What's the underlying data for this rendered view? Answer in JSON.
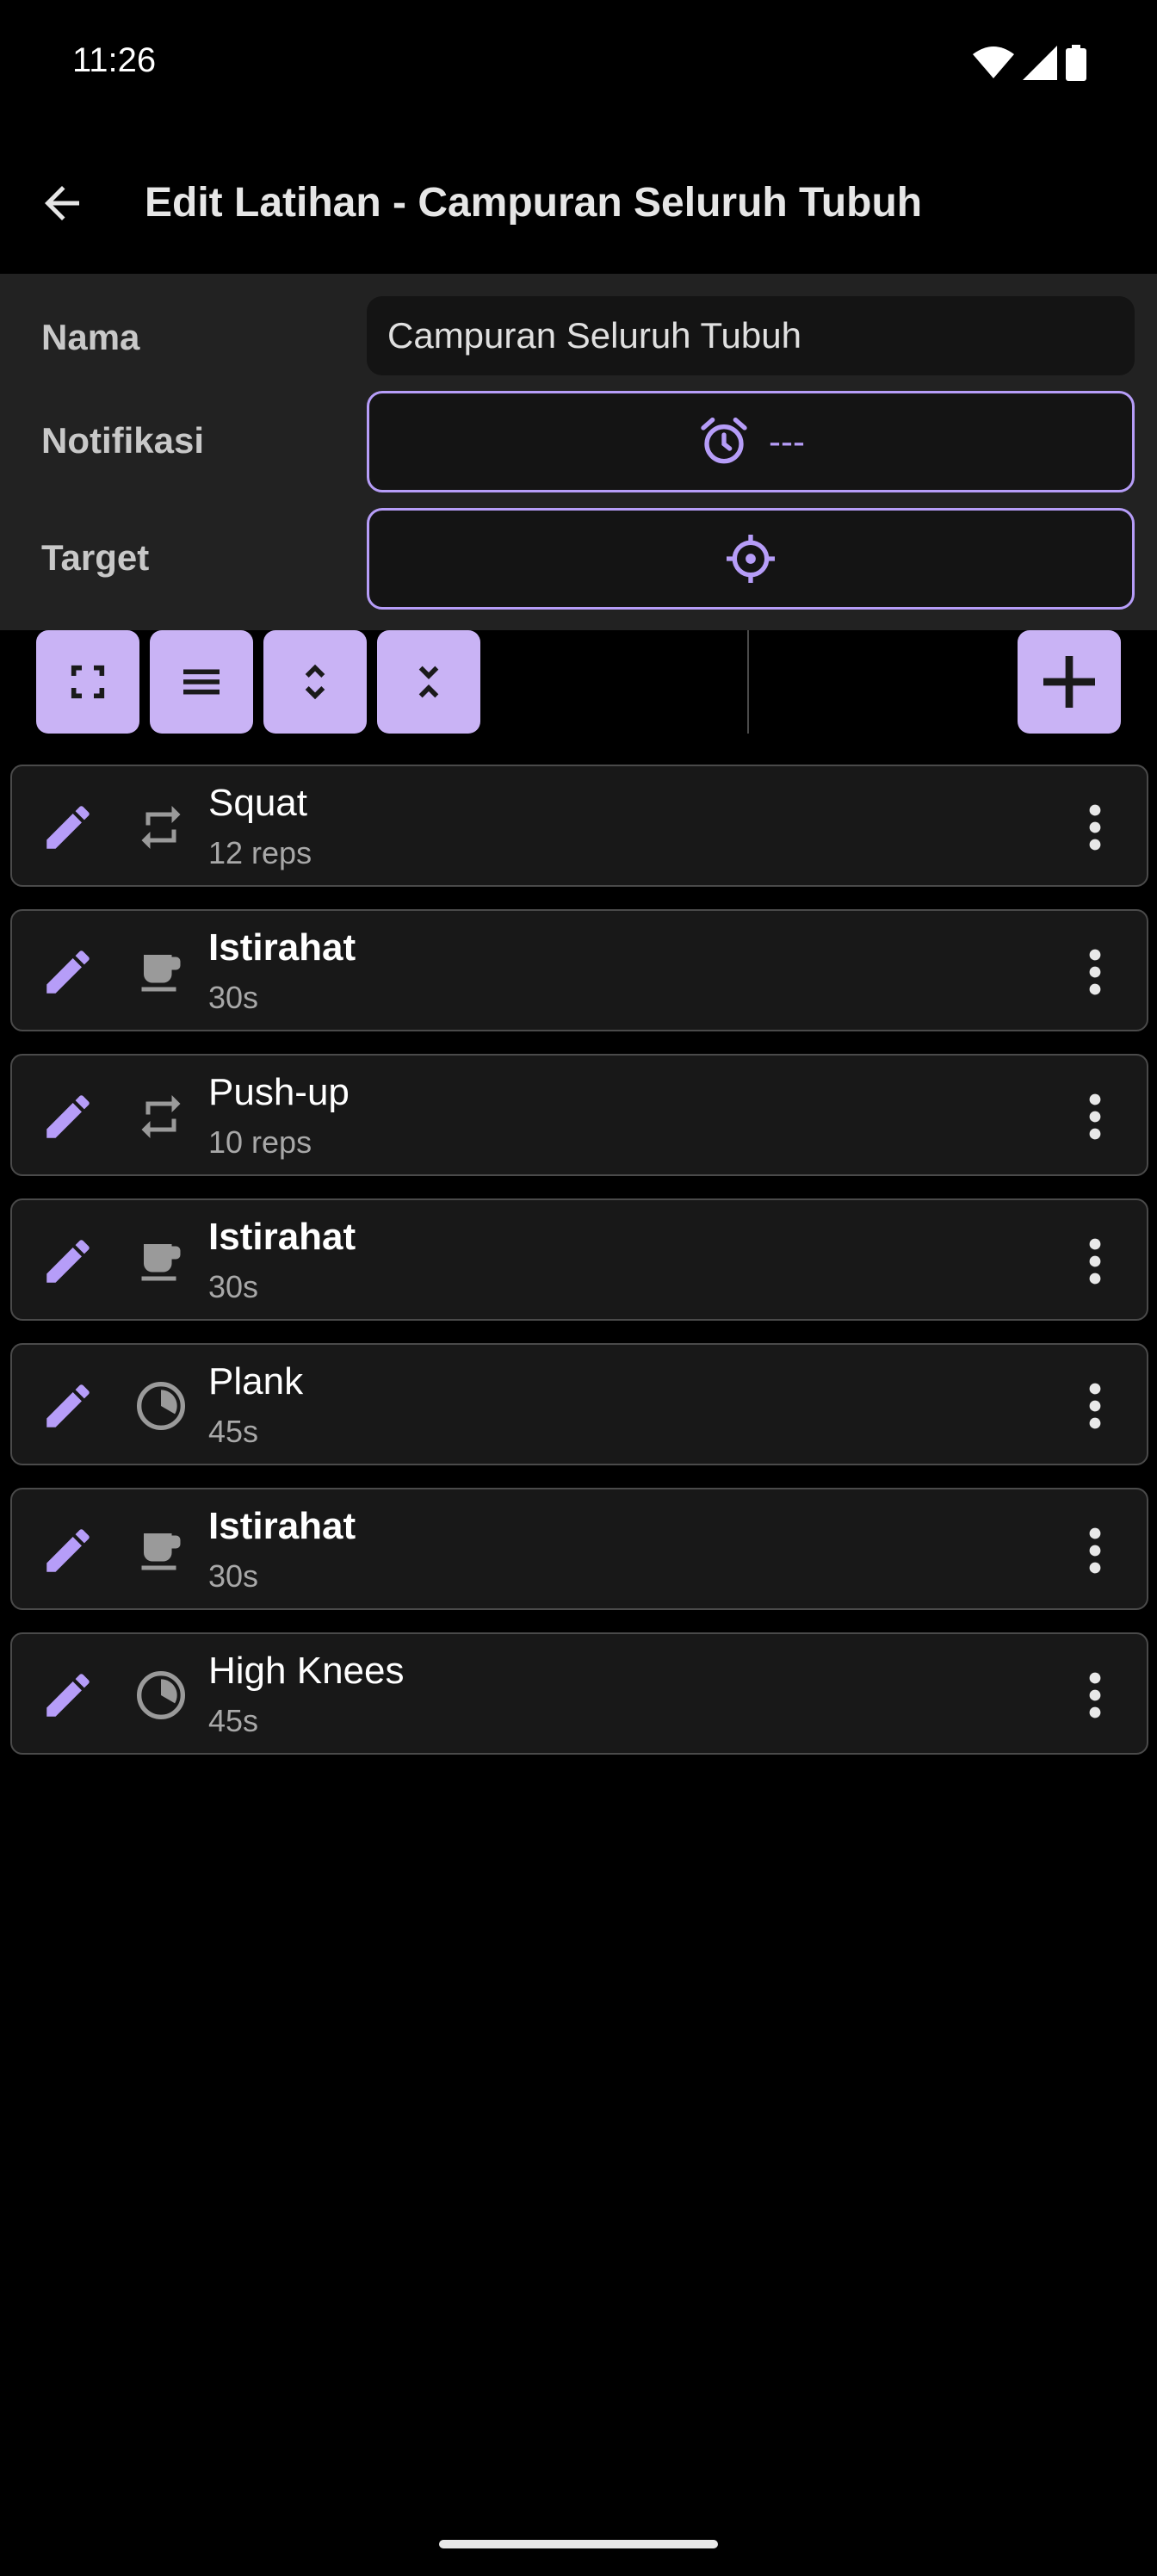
{
  "status_bar": {
    "time": "11:26",
    "icons": [
      "wifi-icon",
      "signal-icon",
      "battery-icon"
    ]
  },
  "app_bar": {
    "title": "Edit Latihan - Campuran Seluruh Tubuh",
    "back_icon": "arrow-back-icon"
  },
  "form": {
    "name_label": "Nama",
    "name_value": "Campuran Seluruh Tubuh",
    "notification_label": "Notifikasi",
    "notification_value": "---",
    "notification_icon": "alarm-icon",
    "target_label": "Target",
    "target_icon": "crosshair-icon"
  },
  "toolbar": {
    "buttons": [
      "fullscreen-icon",
      "list-icon",
      "expand-icon",
      "collapse-icon"
    ],
    "add_icon": "plus-icon"
  },
  "exercises": [
    {
      "name": "Squat",
      "detail": "12 reps",
      "type": "repeat-icon",
      "bold": false
    },
    {
      "name": "Istirahat",
      "detail": "30s",
      "type": "coffee-cup-icon",
      "bold": true
    },
    {
      "name": "Push-up",
      "detail": "10 reps",
      "type": "repeat-icon",
      "bold": false
    },
    {
      "name": "Istirahat",
      "detail": "30s",
      "type": "coffee-cup-icon",
      "bold": true
    },
    {
      "name": "Plank",
      "detail": "45s",
      "type": "timer-pie-icon",
      "bold": false
    },
    {
      "name": "Istirahat",
      "detail": "30s",
      "type": "coffee-cup-icon",
      "bold": true
    },
    {
      "name": "High Knees",
      "detail": "45s",
      "type": "timer-pie-icon",
      "bold": false
    }
  ],
  "colors": {
    "accent": "#b69df8",
    "button_fill": "#c9b3f5",
    "panel": "#222222",
    "item_bg": "#181818",
    "item_border": "#4a4a4a"
  }
}
